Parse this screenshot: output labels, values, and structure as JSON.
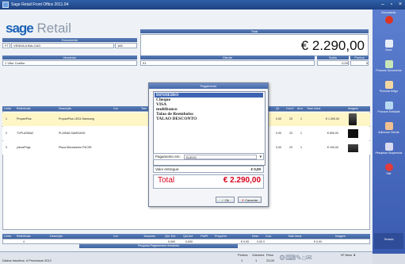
{
  "window": {
    "title": "Sage Retail Front Office 2011.04"
  },
  "logo": {
    "brand": "sage",
    "product": "Retail"
  },
  "header": {
    "documento_label": "Documento",
    "documento_value": "VENDA A BALCAO",
    "documento_prefix": "FT",
    "documento_number": "165",
    "total_label": "Total",
    "total_value": "€ 2.290,00",
    "vendedor_label": "Vendedor",
    "vendedor_value": "1 Vitor Coelho",
    "cliente_label": "Cliente",
    "cliente_value": "01",
    "saldo_label": "Saldo",
    "pontos_label": "Pontos",
    "saldo_value": "0,00",
    "pontos_value": "0"
  },
  "grid": {
    "headers": [
      "Linha",
      "Referência",
      "Descrição",
      "Cor",
      "Tam",
      "Qt.",
      "Cod.2",
      "Arm.",
      "Total Linha",
      "Imagem"
    ],
    "rows": [
      {
        "linha": "1",
        "ref": "PropanPlus",
        "desc": "PropanPlus LED4 Samsung",
        "qt": "1",
        "iva": "0,00",
        "arm": "23",
        "un": "1",
        "total": "€ 1.300,00"
      },
      {
        "linha": "2",
        "ref": "TVPLASMA2",
        "desc": "PLASMA SAMSUNG",
        "qt": "1",
        "iva": "0,00",
        "arm": "23",
        "un": "1",
        "total": "€ 800,00"
      },
      {
        "linha": "3",
        "ref": "ydvcsPhgs",
        "desc": "Placa Microwaves P4C0R",
        "qt": "1",
        "iva": "0,00",
        "arm": "23",
        "un": "1",
        "total": "€ 190,00"
      }
    ]
  },
  "bottom": {
    "headers": [
      "Linha",
      "Referência",
      "Descrição",
      "Cor",
      "Tamanho",
      "Qtd. Ent.",
      "Qtd.Ant.",
      "Fld/Pt",
      "Preço/Un",
      "Desc",
      "Cod.",
      "Total Linha",
      "Imagem"
    ],
    "values": [
      "4",
      "0,000",
      "0,000",
      "€ 0,00",
      "0,00 0",
      "€ 0,00"
    ]
  },
  "status": {
    "text": "Dados Inscritos: 4 Processos 2012",
    "center": "Pesquisa Pagamentos Vendedor",
    "items_label": "Nº Itens",
    "items_value": "3",
    "pontos": "Pontos",
    "volumes": "Volumes",
    "peso": "Peso",
    "totals": [
      "1",
      "1",
      "23,00"
    ]
  },
  "sidepanel": [
    {
      "label": "Documento"
    },
    {
      "label": "Novo"
    },
    {
      "label": "Procurar Documento"
    },
    {
      "label": "Procurar Artigo"
    },
    {
      "label": "Procurar Entidade"
    },
    {
      "label": "Adicionar Cliente"
    },
    {
      "label": "Pesquisar Suspensos"
    },
    {
      "label": "Sair"
    },
    {
      "label": "Teclado"
    }
  ],
  "payment_dialog": {
    "title": "Pagamento",
    "methods": [
      "DINHEIRO",
      "Cheque",
      "VISA",
      "multibanco",
      "Talao de Reembolso",
      "TALAO DESCONTO"
    ],
    "selected_index": 0,
    "payment_label": "Pagamento em:",
    "payment_value": "EUROS",
    "delivered_label": "Valor entregue:",
    "delivered_value": "€ 0,00",
    "total_label": "Total",
    "total_value": "€ 2.290,00",
    "ok_label": "Ok",
    "cancel_label": "Cancelar"
  },
  "colors": {
    "accent": "#3d63b2",
    "total_red": "#d6001c",
    "panel": "#4a6cc0"
  }
}
